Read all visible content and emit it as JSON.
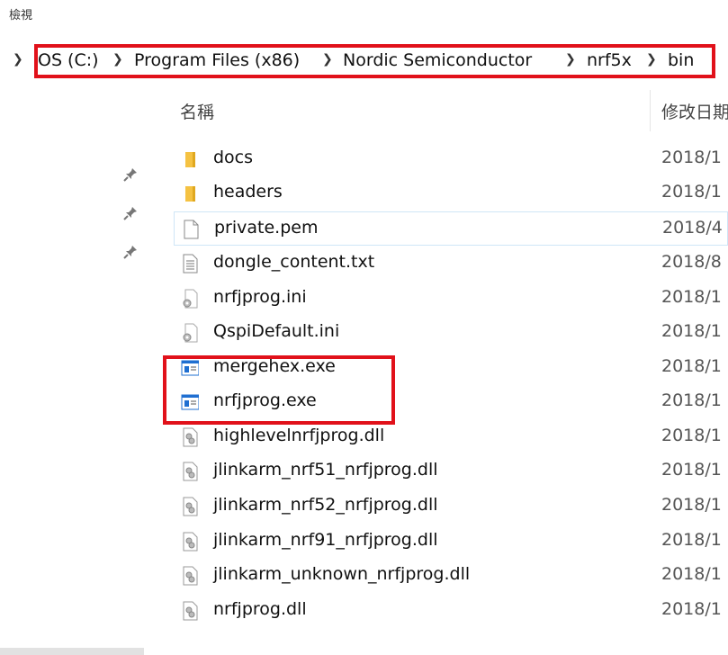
{
  "window": {
    "view_label": "檢視"
  },
  "breadcrumb": {
    "items": [
      "OS (C:)",
      "Program Files (x86)",
      "Nordic Semiconductor",
      "nrf5x",
      "bin"
    ]
  },
  "columns": {
    "name": "名稱",
    "date_modified": "修改日期"
  },
  "files": [
    {
      "name": "docs",
      "date": "2018/1",
      "icon": "folder-icon"
    },
    {
      "name": "headers",
      "date": "2018/1",
      "icon": "folder-icon"
    },
    {
      "name": "private.pem",
      "date": "2018/4",
      "icon": "file-icon"
    },
    {
      "name": "dongle_content.txt",
      "date": "2018/8",
      "icon": "text-file-icon"
    },
    {
      "name": "nrfjprog.ini",
      "date": "2018/1",
      "icon": "settings-file-icon"
    },
    {
      "name": "QspiDefault.ini",
      "date": "2018/1",
      "icon": "settings-file-icon"
    },
    {
      "name": "mergehex.exe",
      "date": "2018/1",
      "icon": "exe-icon"
    },
    {
      "name": "nrfjprog.exe",
      "date": "2018/1",
      "icon": "exe-icon"
    },
    {
      "name": "highlevelnrfjprog.dll",
      "date": "2018/1",
      "icon": "dll-icon"
    },
    {
      "name": "jlinkarm_nrf51_nrfjprog.dll",
      "date": "2018/1",
      "icon": "dll-icon"
    },
    {
      "name": "jlinkarm_nrf52_nrfjprog.dll",
      "date": "2018/1",
      "icon": "dll-icon"
    },
    {
      "name": "jlinkarm_nrf91_nrfjprog.dll",
      "date": "2018/1",
      "icon": "dll-icon"
    },
    {
      "name": "jlinkarm_unknown_nrfjprog.dll",
      "date": "2018/1",
      "icon": "dll-icon"
    },
    {
      "name": "nrfjprog.dll",
      "date": "2018/1",
      "icon": "dll-icon"
    }
  ],
  "colors": {
    "highlight_red": "#e1111a",
    "folder": "#f5c242",
    "exe_blue": "#1f6fd1"
  }
}
